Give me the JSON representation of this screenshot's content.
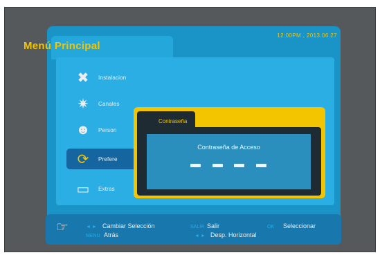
{
  "header": {
    "title": "Menú Principal",
    "datetime": "12:00PM , 2013.06.27"
  },
  "menu": {
    "items": [
      {
        "label": "Instalacion",
        "icon": "tools-icon"
      },
      {
        "label": "Canales",
        "icon": "satellite-icon"
      },
      {
        "label": "Person",
        "icon": "person-icon"
      },
      {
        "label": "Prefere",
        "icon": "refresh-arrows-icon",
        "selected": true
      },
      {
        "label": "Extras",
        "icon": "keyboard-icon"
      }
    ]
  },
  "dialog": {
    "title": "Contraseña",
    "label": "Contraseña de Acceso",
    "password_slots": 4
  },
  "footer": {
    "hints": [
      {
        "key": "◄ ►",
        "text": "Cambiar Selección"
      },
      {
        "key": "SALIR",
        "text": "Salir"
      },
      {
        "key": "OK",
        "text": "Seleccionar"
      },
      {
        "key": "MENU",
        "text": "Atrás"
      },
      {
        "key": "◄ ►",
        "text": "Desp. Horizontal"
      }
    ]
  },
  "colors": {
    "accent_yellow": "#f3c400",
    "panel_blue": "#1a93c6",
    "selected_blue": "#1565a0",
    "dialog_dark": "#1e2b33"
  }
}
